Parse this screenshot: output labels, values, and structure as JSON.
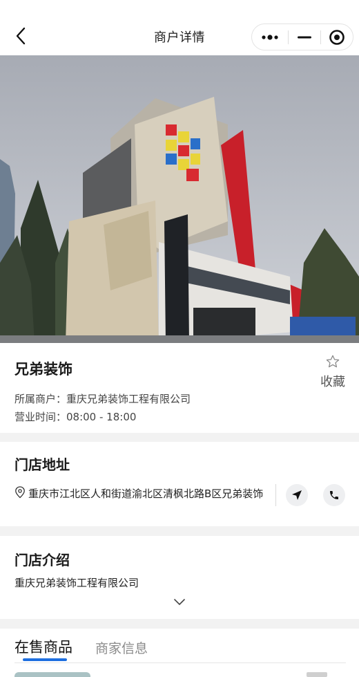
{
  "navbar": {
    "title": "商户详情",
    "back_icon": "chevron-left-icon",
    "capsule_icons": [
      "more-dots-icon",
      "minimize-icon",
      "close-target-icon"
    ]
  },
  "hero": {
    "alt": "store-front-photo"
  },
  "store": {
    "name": "兄弟装饰",
    "favorite_label": "收藏",
    "merchant_line": "所属商户：重庆兄弟装饰工程有限公司",
    "hours_line": "营业时间：08:00 - 18:00"
  },
  "address": {
    "title": "门店地址",
    "text": "重庆市江北区人和街道渝北区清枫北路B区兄弟装饰",
    "pin_icon": "location-pin-icon",
    "navigate_icon": "navigate-arrow-icon",
    "phone_icon": "phone-icon"
  },
  "intro": {
    "title": "门店介绍",
    "text": "重庆兄弟装饰工程有限公司",
    "expand_icon": "chevron-down-icon"
  },
  "tabs": {
    "active": "在售商品",
    "inactive": "商家信息"
  },
  "colors": {
    "accent": "#1e6fe0",
    "page_bg": "#f2f2f2",
    "building_red": "#c8202a"
  }
}
